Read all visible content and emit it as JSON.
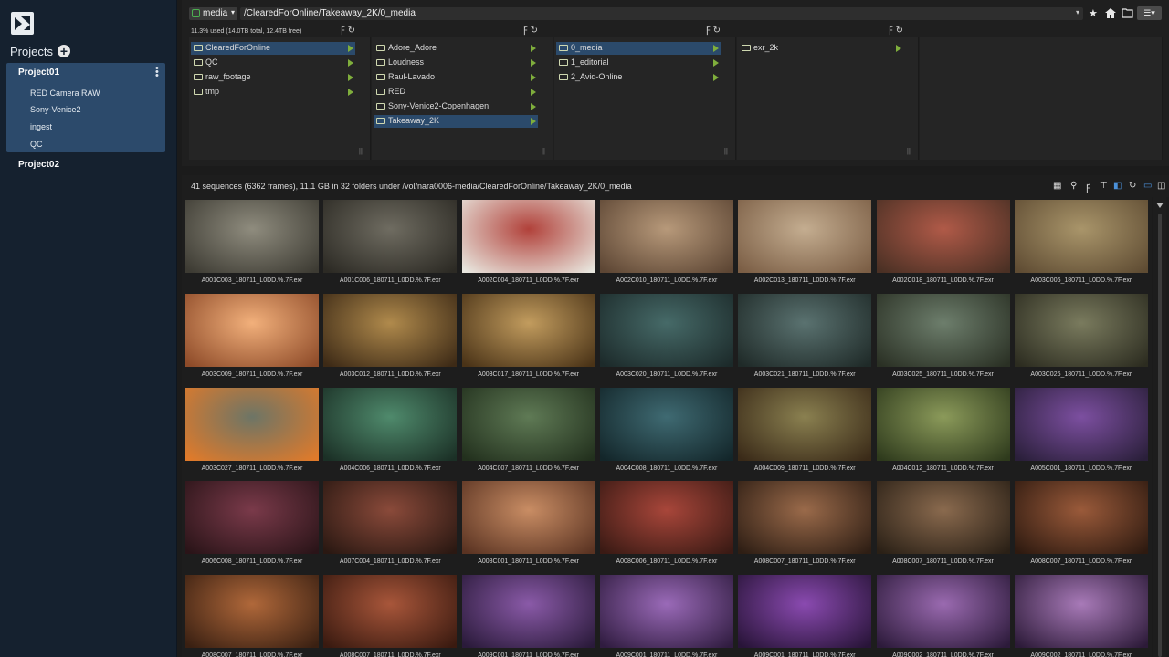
{
  "sidebar": {
    "projects_title": "Projects",
    "add_symbol": "+",
    "project1": {
      "name": "Project01",
      "items": [
        "RED Camera RAW",
        "Sony-Venice2",
        "ingest",
        "QC"
      ]
    },
    "project2": {
      "name": "Project02"
    }
  },
  "topbar": {
    "volume": "media",
    "path": "/ClearedForOnline/Takeaway_2K/0_media",
    "dropdown_symbol": "▾",
    "icons": [
      "star-icon",
      "home-icon",
      "folder-open-icon",
      "view-options-icon"
    ]
  },
  "browser": {
    "usage": "11.3% used (14.0TB total, 12.4TB free)",
    "columns": [
      {
        "items": [
          "ClearedForOnline",
          "QC",
          "raw_footage",
          "tmp"
        ],
        "selected": 0
      },
      {
        "items": [
          "Adore_Adore",
          "Loudness",
          "Raul-Lavado",
          "RED",
          "Sony-Venice2-Copenhagen",
          "Takeaway_2K"
        ],
        "selected": 5
      },
      {
        "items": [
          "0_media",
          "1_editorial",
          "2_Avid-Online"
        ],
        "selected": 0
      },
      {
        "items": [
          "exr_2k"
        ],
        "selected": -1
      }
    ]
  },
  "info": {
    "summary": "41 sequences (6362 frames), 11.1 GB in 32 folders under /vol/nara0006-media/ClearedForOnline/Takeaway_2K/0_media"
  },
  "grid": {
    "tiles": [
      {
        "label": "A001C003_180711_L0DD.%.7F.exr",
        "c1": "#8f8c7e",
        "c2": "#3d3b33"
      },
      {
        "label": "A001C006_180711_L0DD.%.7F.exr",
        "c1": "#6f6c61",
        "c2": "#2c2a24"
      },
      {
        "label": "A002C004_180711_L0DD.%.7F.exr",
        "c1": "#b1413a",
        "c2": "#e8e6de"
      },
      {
        "label": "A002C010_180711_L0DD.%.7F.exr",
        "c1": "#b7997a",
        "c2": "#5d4634"
      },
      {
        "label": "A002C013_180711_L0DD.%.7F.exr",
        "c1": "#c4ad90",
        "c2": "#7b5e45"
      },
      {
        "label": "A002C018_180711_L0DD.%.7F.exr",
        "c1": "#b05a48",
        "c2": "#4a3024"
      },
      {
        "label": "A003C006_180711_L0DD.%.7F.exr",
        "c1": "#a9956a",
        "c2": "#5f4c33"
      },
      {
        "label": "A003C009_180711_L0DD.%.7F.exr",
        "c1": "#f2b07b",
        "c2": "#8e4b29"
      },
      {
        "label": "A003C012_180711_L0DD.%.7F.exr",
        "c1": "#b08a4c",
        "c2": "#3d2a16"
      },
      {
        "label": "A003C017_180711_L0DD.%.7F.exr",
        "c1": "#c29c5e",
        "c2": "#4a3317"
      },
      {
        "label": "A003C020_180711_L0DD.%.7F.exr",
        "c1": "#466a68",
        "c2": "#1c2a2a"
      },
      {
        "label": "A003C021_180711_L0DD.%.7F.exr",
        "c1": "#5a7270",
        "c2": "#1f2a28"
      },
      {
        "label": "A003C025_180711_L0DD.%.7F.exr",
        "c1": "#6d7e6c",
        "c2": "#2a3024"
      },
      {
        "label": "A003C026_180711_L0DD.%.7F.exr",
        "c1": "#7a7b5e",
        "c2": "#2c2c20"
      },
      {
        "label": "A003C027_180711_L0DD.%.7F.exr",
        "c1": "#6d7566",
        "c2": "#e07a2a"
      },
      {
        "label": "A004C006_180711_L0DD.%.7F.exr",
        "c1": "#4f8a6c",
        "c2": "#1b3026"
      },
      {
        "label": "A004C007_180711_L0DD.%.7F.exr",
        "c1": "#5f7a55",
        "c2": "#22301d"
      },
      {
        "label": "A004C008_180711_L0DD.%.7F.exr",
        "c1": "#3f6a72",
        "c2": "#13262a"
      },
      {
        "label": "A004C009_180711_L0DD.%.7F.exr",
        "c1": "#8a8050",
        "c2": "#3a2a18"
      },
      {
        "label": "A004C012_180711_L0DD.%.7F.exr",
        "c1": "#8b9a5a",
        "c2": "#2e3a1c"
      },
      {
        "label": "A005C001_180711_L0DD.%.7F.exr",
        "c1": "#7c4fa0",
        "c2": "#2a1f3a"
      },
      {
        "label": "A006C008_180711_L0DD.%.7F.exr",
        "c1": "#7a3a4a",
        "c2": "#2a1418"
      },
      {
        "label": "A007C004_180711_L0DD.%.7F.exr",
        "c1": "#8a4a3a",
        "c2": "#2a1812"
      },
      {
        "label": "A008C001_180711_L0DD.%.7F.exr",
        "c1": "#c98d64",
        "c2": "#5a3322"
      },
      {
        "label": "A008C006_180711_L0DD.%.7F.exr",
        "c1": "#a8463a",
        "c2": "#3a1a14"
      },
      {
        "label": "A008C007_180711_L0DD.%.7F.exr",
        "c1": "#9a6a4a",
        "c2": "#2e1e14"
      },
      {
        "label": "A008C007_180711_L0DD.%.7F.exr",
        "c1": "#8a6a4e",
        "c2": "#2a2016"
      },
      {
        "label": "A008C007_180711_L0DD.%.7F.exr",
        "c1": "#9a5a3a",
        "c2": "#2e1a10"
      },
      {
        "label": "A008C007_180711_L0DD.%.7F.exr",
        "c1": "#b0683a",
        "c2": "#3a2012"
      },
      {
        "label": "A008C007_180711_L0DD.%.7F.exr",
        "c1": "#a8563a",
        "c2": "#3a1a10"
      },
      {
        "label": "A009C001_180711_L0DD.%.7F.exr",
        "c1": "#8a5aa8",
        "c2": "#2a1a3a"
      },
      {
        "label": "A009C001_180711_L0DD.%.7F.exr",
        "c1": "#9a6ab8",
        "c2": "#301c40"
      },
      {
        "label": "A009C001_180711_L0DD.%.7F.exr",
        "c1": "#8a4ab0",
        "c2": "#281438"
      },
      {
        "label": "A009C002_180711_L0DD.%.7F.exr",
        "c1": "#9a6ab0",
        "c2": "#2c1a3a"
      },
      {
        "label": "A009C002_180711_L0DD.%.7F.exr",
        "c1": "#a87ab8",
        "c2": "#2c1a38"
      }
    ]
  }
}
